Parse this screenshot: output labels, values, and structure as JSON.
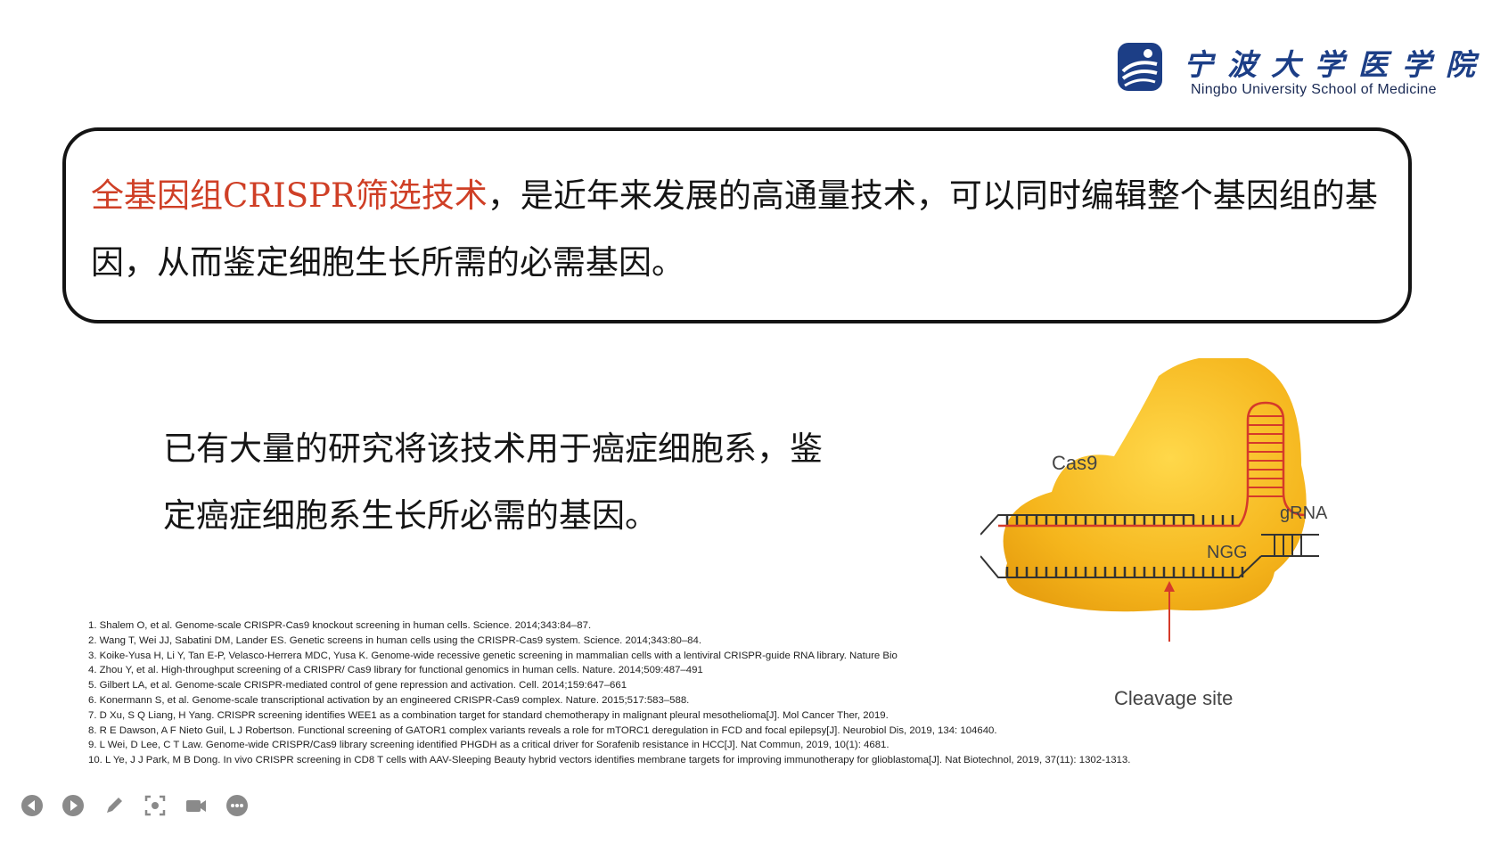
{
  "logo": {
    "cn": "宁波大学医学院",
    "en": "Ningbo University School of Medicine"
  },
  "callout": {
    "highlight": "全基因组CRISPR筛选技术",
    "rest": "，是近年来发展的高通量技术，可以同时编辑整个基因组的基因，从而鉴定细胞生长所需的必需基因。"
  },
  "body": {
    "text": "已有大量的研究将该技术用于癌症细胞系，鉴定癌症细胞系生长所必需的基因。"
  },
  "figure": {
    "cas9_label": "Cas9",
    "grna_label": "gRNA",
    "ngg_label": "NGG",
    "cleavage_label": "Cleavage site"
  },
  "references": [
    "1. Shalem O, et al. Genome-scale CRISPR-Cas9 knockout screening in human cells. Science. 2014;343:84–87.",
    "2. Wang T, Wei JJ, Sabatini DM, Lander ES. Genetic screens in human cells using the CRISPR-Cas9 system. Science. 2014;343:80–84.",
    "3. Koike-Yusa H, Li Y, Tan E-P, Velasco-Herrera MDC, Yusa K. Genome-wide recessive genetic screening in mammalian cells with a lentiviral CRISPR-guide RNA library. Nature Bio",
    "4. Zhou Y, et al. High-throughput screening of a CRISPR/ Cas9 library for functional genomics in human cells. Nature. 2014;509:487–491",
    "5. Gilbert LA, et al. Genome-scale CRISPR-mediated control of gene repression and activation. Cell. 2014;159:647–661",
    "6. Konermann S, et al. Genome-scale transcriptional activation by an engineered CRISPR-Cas9 complex. Nature. 2015;517:583–588.",
    "7. D Xu, S Q Liang, H Yang. CRISPR screening identifies WEE1 as a combination target for standard chemotherapy in malignant pleural mesothelioma[J]. Mol Cancer Ther, 2019.",
    "8. R E Dawson, A F Nieto Guil, L J Robertson. Functional screening of GATOR1 complex variants reveals a role for mTORC1 deregulation in FCD and focal epilepsy[J]. Neurobiol Dis, 2019, 134: 104640.",
    "9. L Wei, D Lee, C T Law. Genome-wide CRISPR/Cas9 library screening identified PHGDH as a critical driver for Sorafenib resistance in HCC[J]. Nat Commun, 2019, 10(1): 4681.",
    "10. L Ye, J J Park, M B Dong. In vivo CRISPR screening in CD8 T cells with AAV-Sleeping Beauty hybrid vectors identifies membrane targets for improving immunotherapy for glioblastoma[J]. Nat Biotechnol, 2019, 37(11): 1302-1313."
  ],
  "toolbar": [
    {
      "icon": "previous-slide-icon"
    },
    {
      "icon": "next-slide-icon"
    },
    {
      "icon": "pen-icon"
    },
    {
      "icon": "zoom-icon"
    },
    {
      "icon": "camera-icon"
    },
    {
      "icon": "more-options-icon"
    }
  ],
  "colors": {
    "highlight": "#cf3f26",
    "logo_blue": "#1c3e86",
    "cas9_yellow": "#f5b51c",
    "dna_red": "#d53a2a"
  }
}
